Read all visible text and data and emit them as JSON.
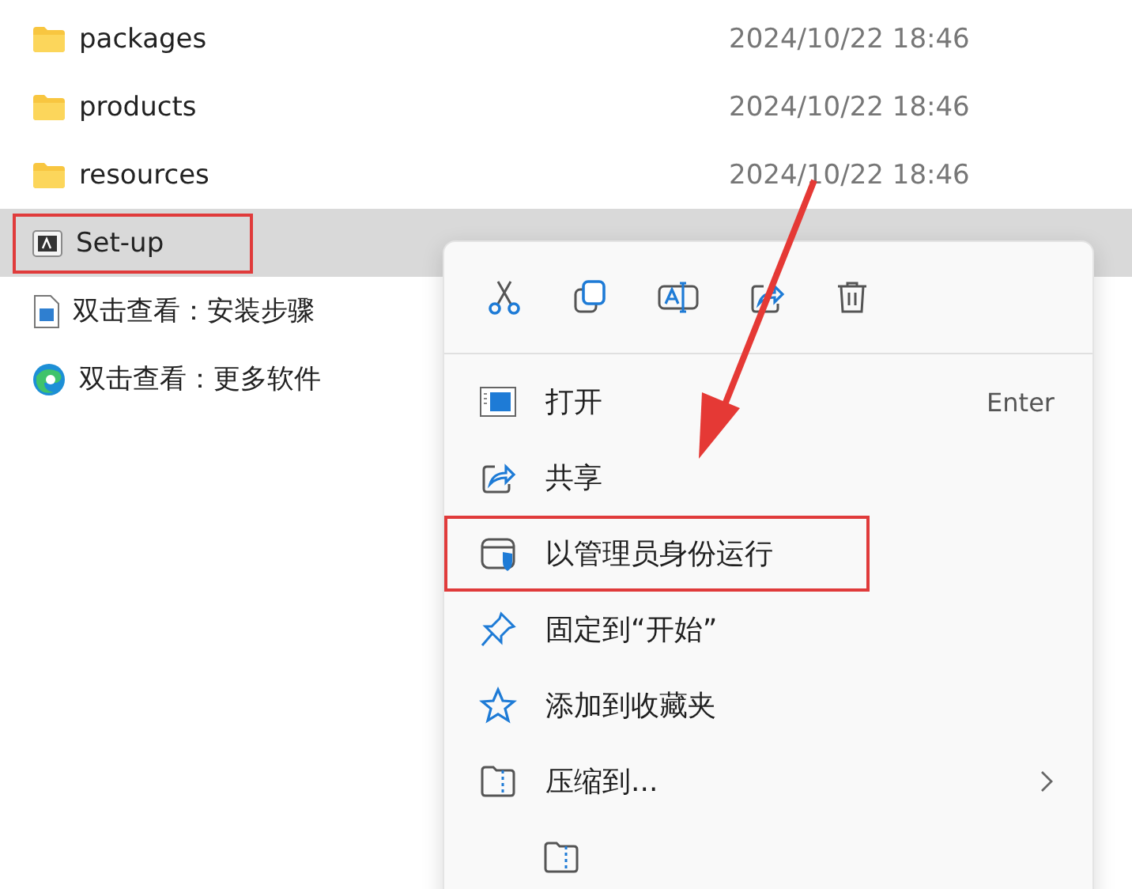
{
  "files": [
    {
      "kind": "folder",
      "name": "packages",
      "date": "2024/10/22 18:46",
      "selected": false,
      "annotated": false
    },
    {
      "kind": "folder",
      "name": "products",
      "date": "2024/10/22 18:46",
      "selected": false,
      "annotated": false
    },
    {
      "kind": "folder",
      "name": "resources",
      "date": "2024/10/22 18:46",
      "selected": false,
      "annotated": false
    },
    {
      "kind": "app",
      "name": "Set-up",
      "selected": true,
      "annotated": true
    },
    {
      "kind": "image",
      "name": "双击查看：安装步骤",
      "selected": false,
      "annotated": false
    },
    {
      "kind": "browser",
      "name": "双击查看：更多软件",
      "selected": false,
      "annotated": false
    }
  ],
  "context_menu": {
    "toolbar": [
      {
        "kind": "cut"
      },
      {
        "kind": "copy"
      },
      {
        "kind": "rename"
      },
      {
        "kind": "share"
      },
      {
        "kind": "delete"
      }
    ],
    "items": [
      {
        "kind": "open",
        "label": "打开",
        "shortcut": "Enter",
        "annotated": false
      },
      {
        "kind": "share",
        "label": "共享",
        "annotated": false
      },
      {
        "kind": "admin",
        "label": "以管理员身份运行",
        "annotated": true
      },
      {
        "kind": "pin",
        "label": "固定到“开始”",
        "annotated": false
      },
      {
        "kind": "star",
        "label": "添加到收藏夹",
        "annotated": false
      },
      {
        "kind": "zip",
        "label": "压缩到...",
        "submenu": true,
        "annotated": false
      },
      {
        "kind": "zip-small"
      }
    ]
  }
}
